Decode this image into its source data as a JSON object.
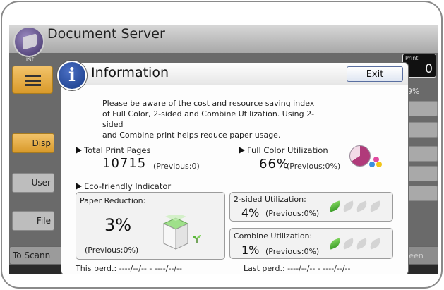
{
  "background": {
    "window_title": "Document Server",
    "list_label": "List",
    "left_buttons": [
      "Disp",
      "User",
      "File"
    ],
    "print_label": "Print",
    "print_count": "0",
    "percent": "99%",
    "bottom_left_button": "To Scann",
    "bottom_right_button": "Screen"
  },
  "dialog": {
    "title": "Information",
    "exit_label": "Exit",
    "notice_lines": [
      "Please be aware of the cost and resource saving index",
      "of Full Color, 2-sided and Combine Utilization. Using 2-sided",
      "and Combine print helps reduce paper usage."
    ],
    "total_pages": {
      "label": "Total Print Pages",
      "value": "10715",
      "previous": "(Previous:0)"
    },
    "full_color": {
      "label": "Full Color Utilization",
      "value": "66%",
      "previous": "(Previous:0%)",
      "fraction": 0.66
    },
    "eco_label": "Eco-friendly Indicator",
    "paper_reduction": {
      "label": "Paper Reduction:",
      "value": "3%",
      "previous": "(Previous:0%)"
    },
    "two_sided": {
      "label": "2-sided Utilization:",
      "value": "4%",
      "previous": "(Previous:0%)",
      "leaves_on": 1,
      "leaves_total": 4
    },
    "combine": {
      "label": "Combine Utilization:",
      "value": "1%",
      "previous": "(Previous:0%)",
      "leaves_on": 1,
      "leaves_total": 4
    },
    "this_period": "This perd.:  ----/--/-- - ----/--/--",
    "last_period": "Last perd.:  ----/--/-- - ----/--/--"
  },
  "colors": {
    "leaf_on": "#4aab34",
    "leaf_off": "#d4d4d4",
    "pie_fill": "#b03a7a",
    "info_badge": "#1f4fa8"
  },
  "icons": [
    "info-icon",
    "pie-chart-icon",
    "color-dots-icon",
    "paper-box-icon",
    "sprout-icon",
    "leaf-icon",
    "list-icon"
  ]
}
